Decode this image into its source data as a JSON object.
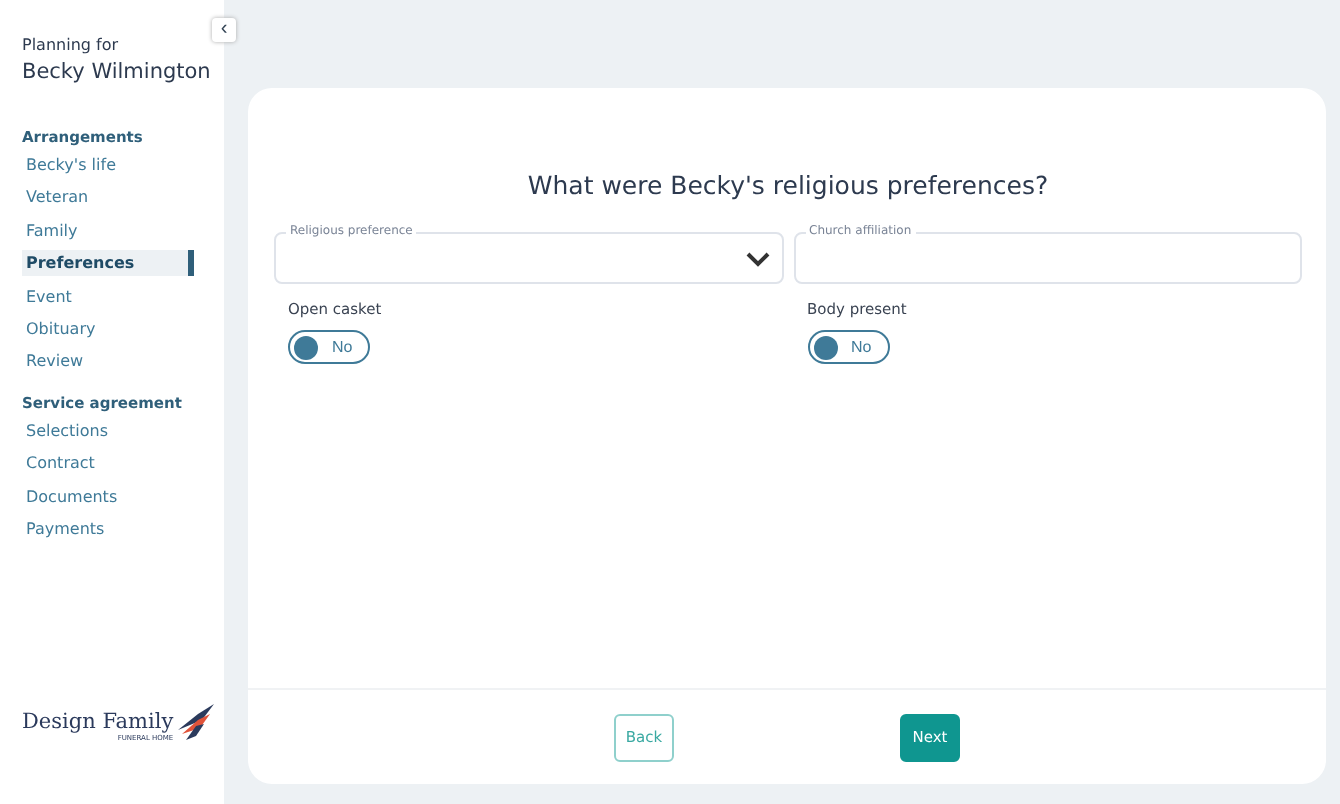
{
  "sidebar": {
    "planning_label": "Planning for",
    "person_name": "Becky Wilmington",
    "sections": [
      {
        "heading": "Arrangements",
        "items": [
          {
            "label": "Becky's life",
            "selected": false
          },
          {
            "label": "Veteran",
            "selected": false
          },
          {
            "label": "Family",
            "selected": false
          },
          {
            "label": "Preferences",
            "selected": true
          },
          {
            "label": "Event",
            "selected": false
          },
          {
            "label": "Obituary",
            "selected": false
          },
          {
            "label": "Review",
            "selected": false
          }
        ]
      },
      {
        "heading": "Service agreement",
        "items": [
          {
            "label": "Selections",
            "selected": false
          },
          {
            "label": "Contract",
            "selected": false
          },
          {
            "label": "Documents",
            "selected": false
          },
          {
            "label": "Payments",
            "selected": false
          }
        ]
      }
    ],
    "logo": {
      "name": "Design Family",
      "tagline": "FUNERAL HOME"
    },
    "collapse_icon": "‹"
  },
  "form": {
    "question": "What were Becky's religious preferences?",
    "fields": [
      {
        "kind": "select",
        "label": "Religious preference"
      },
      {
        "kind": "text",
        "label": "Church affiliation"
      }
    ],
    "toggles": [
      {
        "label": "Open casket",
        "on": false,
        "value": "No"
      },
      {
        "label": "Body present",
        "on": false,
        "value": "No"
      }
    ],
    "buttons": [
      {
        "kind": "secondary",
        "label": "Back"
      },
      {
        "kind": "primary",
        "label": "Next"
      }
    ]
  }
}
